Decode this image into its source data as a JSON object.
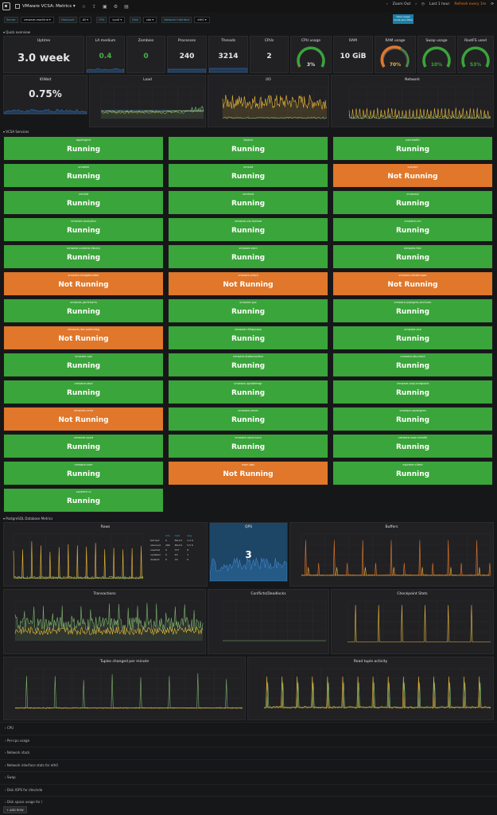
{
  "topbar": {
    "title": "VMware VCSA: Metrics",
    "zoom_out": "Zoom Out",
    "time_range": "Last 1 hour",
    "refresh": "Refresh every 1m"
  },
  "variables": [
    {
      "label": "Server",
      "value": "vmware-machine"
    },
    {
      "label": "Host:port",
      "value": "All"
    },
    {
      "label": "CPU",
      "value": "cpu0"
    },
    {
      "label": "Disk",
      "value": "sda"
    },
    {
      "label": "Network interface",
      "value": "eth0"
    }
  ],
  "variables_button": "View usage mode and CPUs",
  "rows": {
    "quick": "Quick overview",
    "services": "VCSA Services",
    "pg": "PostgreSQL Database Metrics"
  },
  "stats": {
    "uptime": {
      "title": "Uptime",
      "value": "3.0 week"
    },
    "la": {
      "title": "LA medium",
      "value": "0.4"
    },
    "zombies": {
      "title": "Zombies",
      "value": "0"
    },
    "processes": {
      "title": "Processes",
      "value": "240"
    },
    "threads": {
      "title": "Threads",
      "value": "3214"
    },
    "cpus": {
      "title": "CPUs",
      "value": "2"
    },
    "cpu_usage": {
      "title": "CPU usage",
      "value": "3%",
      "pct": 3
    },
    "ram": {
      "title": "RAM",
      "value": "10 GiB"
    },
    "ram_usage": {
      "title": "RAM usage",
      "value": "70%",
      "pct": 70
    },
    "swap": {
      "title": "Swap usage",
      "value": "10%",
      "pct": 10
    },
    "rootfs": {
      "title": "RootFS used",
      "value": "53%",
      "pct": 53
    },
    "iowait": {
      "title": "IOWait",
      "value": "0.75%"
    }
  },
  "graphs": {
    "load": "Load",
    "io": "I/O",
    "network": "Network",
    "rows": "Rows",
    "qps": "QPS",
    "qps_value": "3",
    "buffers": "Buffers",
    "transactions": "Transactions",
    "conflicts": "Conflicts/Deadlocks",
    "checkpoint": "Checkpoint Stats",
    "tuples": "Tuples changed per minute",
    "read_tuple": "Read tuple activity"
  },
  "status_running": "Running",
  "status_not_running": "Not Running",
  "services": [
    {
      "name": "applmgmt",
      "ok": true
    },
    {
      "name": "lwsmd",
      "ok": true
    },
    {
      "name": "pschealth",
      "ok": true
    },
    {
      "name": "vmafdd",
      "ok": true
    },
    {
      "name": "vmcad",
      "ok": true
    },
    {
      "name": "vmcam",
      "ok": false
    },
    {
      "name": "vmdird",
      "ok": true
    },
    {
      "name": "vmdnsd",
      "ok": true
    },
    {
      "name": "vmonapi",
      "ok": true
    },
    {
      "name": "vmware-analytics",
      "ok": true
    },
    {
      "name": "vmware-cis-license",
      "ok": true
    },
    {
      "name": "vmware-cm",
      "ok": true
    },
    {
      "name": "vmware-content-library",
      "ok": true
    },
    {
      "name": "vmware-eam",
      "ok": true
    },
    {
      "name": "vmware-fmc",
      "ok": true
    },
    {
      "name": "vmware-imagebuilder",
      "ok": false
    },
    {
      "name": "vmware-mbcs",
      "ok": false
    },
    {
      "name": "vmware-netdumper",
      "ok": false
    },
    {
      "name": "vmware-perfcharts",
      "ok": true
    },
    {
      "name": "vmware-psc",
      "ok": true
    },
    {
      "name": "vmware-postgres-archiver",
      "ok": true
    },
    {
      "name": "vmware-rbd-watchdog",
      "ok": false
    },
    {
      "name": "vmware-rhttpproxy",
      "ok": true
    },
    {
      "name": "vmware-sca",
      "ok": true
    },
    {
      "name": "vmware-sps",
      "ok": true
    },
    {
      "name": "vmware-statsmonitor",
      "ok": true
    },
    {
      "name": "vmware-sts-idmd",
      "ok": true
    },
    {
      "name": "vmware-stsd",
      "ok": true
    },
    {
      "name": "vmware-updatemgr",
      "ok": true
    },
    {
      "name": "vmware-vapi-endpoint",
      "ok": true
    },
    {
      "name": "vmware-vcha",
      "ok": false
    },
    {
      "name": "vmware-vmon",
      "ok": true
    },
    {
      "name": "vmware-vpostgres",
      "ok": true
    },
    {
      "name": "vmware-vpxd",
      "ok": true
    },
    {
      "name": "vmware-vpxd-svcs",
      "ok": true
    },
    {
      "name": "vmware-vsan-health",
      "ok": true
    },
    {
      "name": "vmware-vsm",
      "ok": true
    },
    {
      "name": "vsan-dps",
      "ok": false
    },
    {
      "name": "vsphere-client",
      "ok": true
    },
    {
      "name": "vsphere-ui",
      "ok": true
    }
  ],
  "rows_legend": {
    "headers": [
      "",
      "min",
      "max",
      "avg"
    ],
    "rows": [
      [
        "fetched",
        "0",
        "86.9 K",
        "2.2 K"
      ],
      [
        "returned",
        "266",
        "86.6 K",
        "5.5 K"
      ],
      [
        "inserted",
        "0",
        "377",
        "8"
      ],
      [
        "updated",
        "0",
        "20",
        "1"
      ],
      [
        "deleted",
        "0",
        "16",
        "0"
      ]
    ]
  },
  "collapsed_rows": [
    "CPU",
    "Per-cpu usage",
    "Network stack",
    "Network interface stats for eth0",
    "Swap",
    "Disk IOPS for /dev/sda",
    "Disk space usage for /"
  ],
  "add_row": "ADD ROW",
  "colors": {
    "running": "#3aa53a",
    "not_running": "#e0772a",
    "green": "#7eb26d",
    "yellow": "#eab839",
    "blue": "#1f78c1"
  }
}
